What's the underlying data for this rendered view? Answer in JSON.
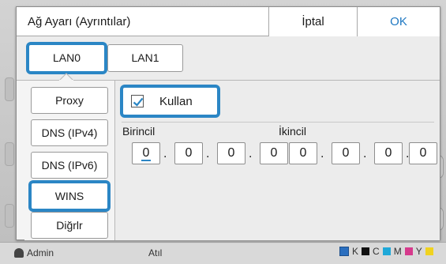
{
  "background": {
    "user_label": "Admin",
    "mid_label": "Atıl",
    "ink_labels": [
      "K",
      "C",
      "M",
      "Y"
    ]
  },
  "dialog": {
    "title": "Ağ Ayarı (Ayrıntılar)",
    "cancel_label": "İptal",
    "ok_label": "OK"
  },
  "tabs": [
    {
      "label": "LAN0",
      "selected": true
    },
    {
      "label": "LAN1",
      "selected": false
    }
  ],
  "side_menu": [
    {
      "label": "Proxy",
      "selected": false
    },
    {
      "label": "DNS (IPv4)",
      "selected": false
    },
    {
      "label": "DNS (IPv6)",
      "selected": false
    },
    {
      "label": "WINS",
      "selected": true
    },
    {
      "label": "Diğrlr",
      "selected": false
    }
  ],
  "wins": {
    "use_label": "Kullan",
    "use_checked": true,
    "primary_label": "Birincil",
    "primary": [
      "0",
      "0",
      "0",
      "0"
    ],
    "secondary_label": "İkincil",
    "secondary": [
      "0",
      "0",
      "0",
      "0"
    ]
  },
  "colors": {
    "accent": "#2b86c5",
    "ok_text": "#1f78c2"
  }
}
